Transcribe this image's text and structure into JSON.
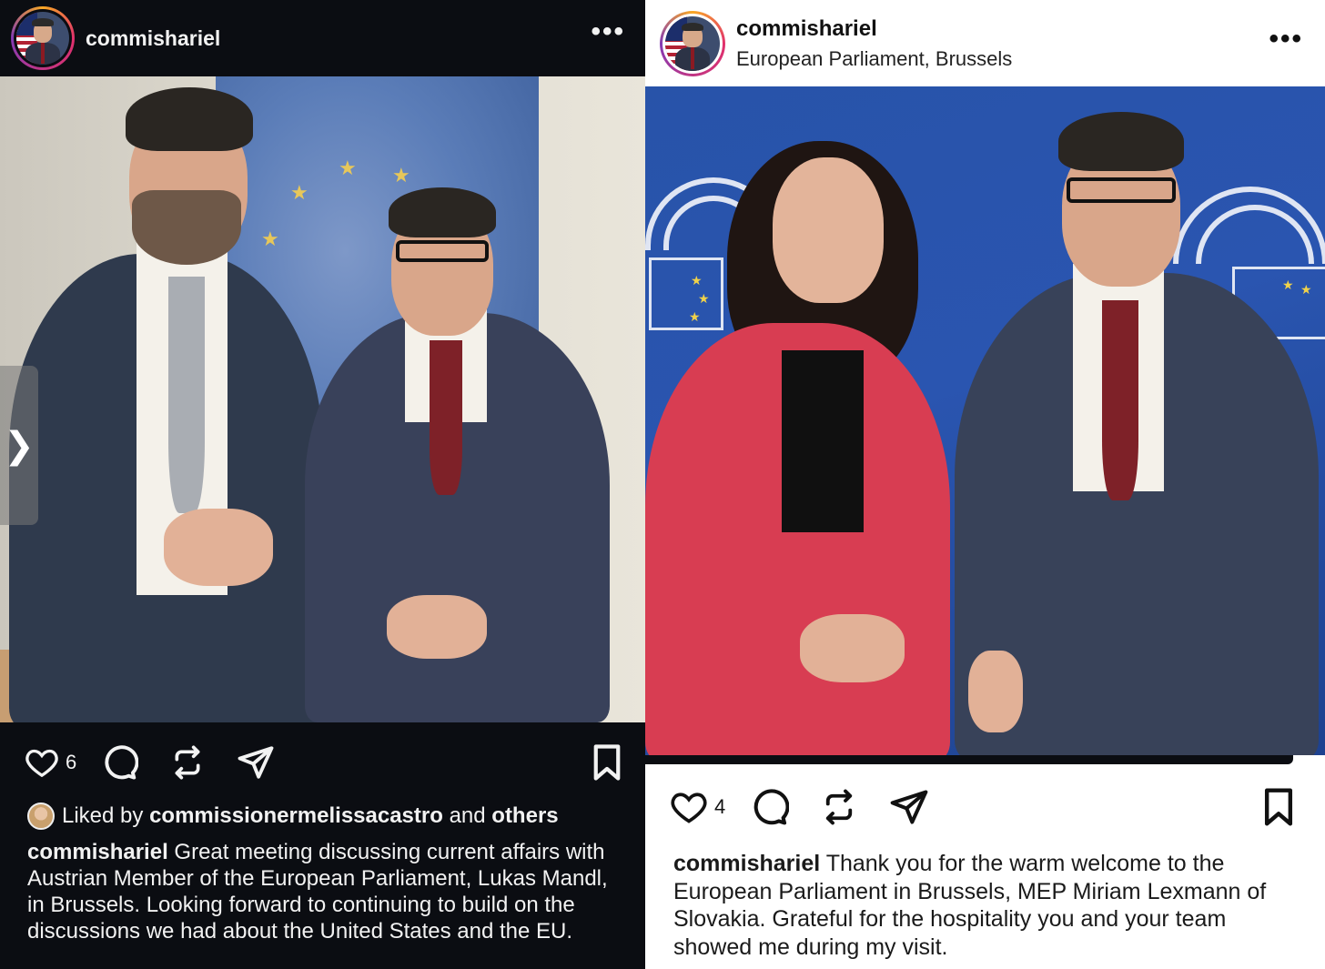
{
  "left_post": {
    "username": "commishariel",
    "more_label": "•••",
    "likes_count": "6",
    "liked_by_prefix": "Liked by",
    "liked_by_user": "commissionermelissacastro",
    "liked_by_and": "and",
    "liked_by_others": "others",
    "caption_user": "commishariel",
    "caption_text": "Great meeting discussing current affairs with Austrian Member of the European Parliament, Lukas Mandl, in Brussels. Looking forward to continuing to build on the discussions we had about the United States and the EU.",
    "carousel_next": "❯"
  },
  "right_post": {
    "username": "commishariel",
    "location": "European Parliament, Brussels",
    "more_label": "•••",
    "likes_count": "4",
    "caption_user": "commishariel",
    "caption_text": "Thank you for the warm welcome to the European Parliament in Brussels, MEP Miriam Lexmann of Slovakia. Grateful for the hospitality you and your team showed me during my visit."
  },
  "icons": {
    "like": "heart-icon",
    "comment": "comment-icon",
    "repost": "repost-icon",
    "share": "share-icon",
    "save": "bookmark-icon"
  },
  "colors": {
    "dark_bg": "#0b0d12",
    "ep_blue": "#2853a9",
    "blazer_red": "#d83d52"
  }
}
